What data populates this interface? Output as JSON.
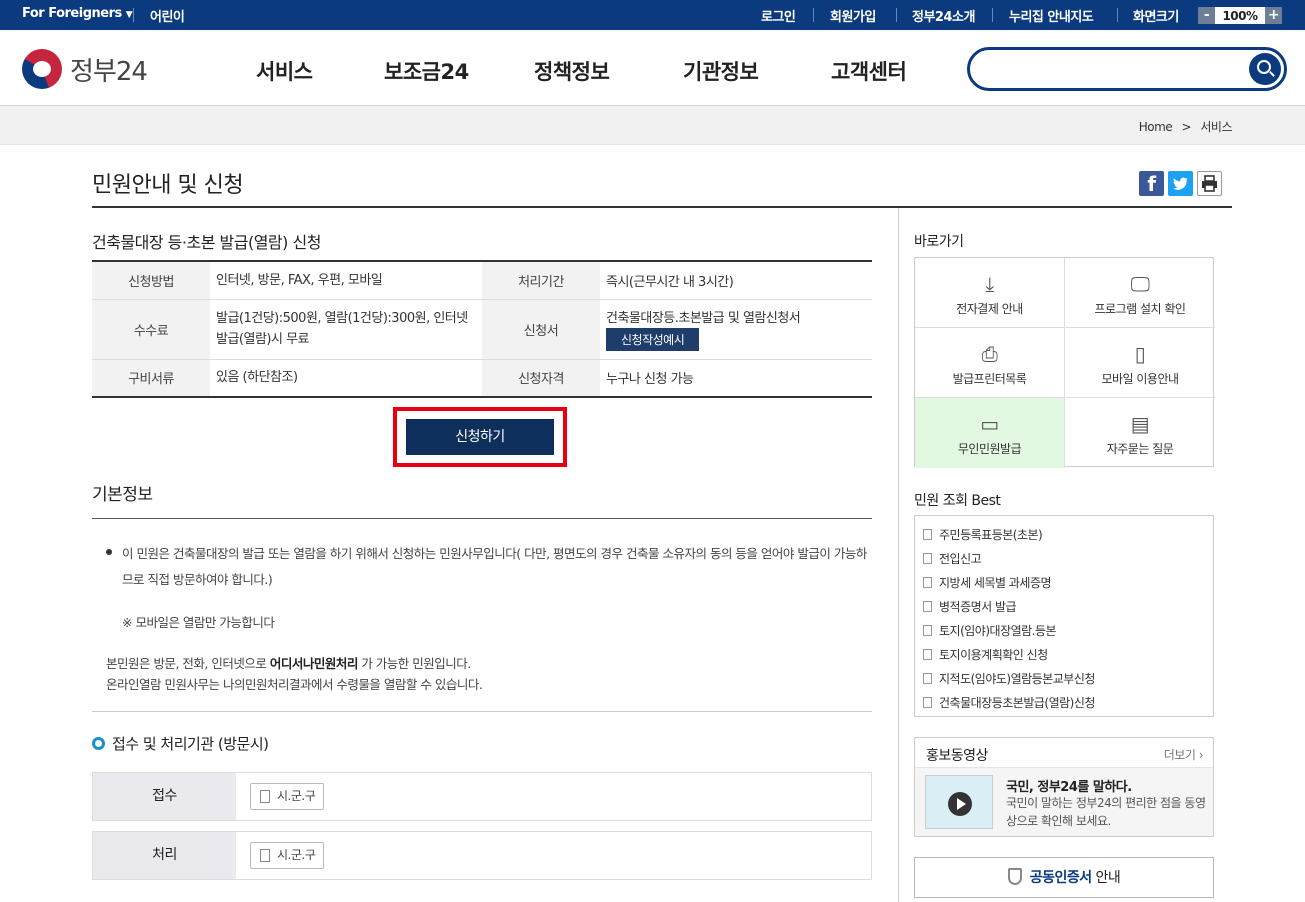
{
  "topbar": {
    "foreigners": "For Foreigners",
    "kids": "어린이",
    "links": [
      "로그인",
      "회원가입",
      "정부24소개",
      "누리집 안내지도",
      "화면크기"
    ],
    "zoom_minus": "-",
    "zoom_value": "100%",
    "zoom_plus": "+"
  },
  "header": {
    "logo_text": "정부24",
    "nav": [
      "서비스",
      "보조금24",
      "정책정보",
      "기관정보",
      "고객센터"
    ],
    "search_placeholder": ""
  },
  "breadcrumb": {
    "home": "Home",
    "sep": ">",
    "current": "서비스"
  },
  "page": {
    "title": "민원안내 및 신청",
    "service_title": "건축물대장 등·초본 발급(열람) 신청"
  },
  "info_table": {
    "method_label": "신청방법",
    "method_value": "인터넷, 방문, FAX, 우편, 모바일",
    "period_label": "처리기간",
    "period_value": "즉시(근무시간 내 3시간)",
    "fee_label": "수수료",
    "fee_value": "발급(1건당):500원, 열람(1건당):300원, 인터넷 발급(열람)시 무료",
    "form_label": "신청서",
    "form_value": "건축물대장등.초본발급 및 열람신청서",
    "form_sample_button": "신청작성예시",
    "docs_label": "구비서류",
    "docs_value": "있음 (하단참조)",
    "qual_label": "신청자격",
    "qual_value": "누구나 신청 가능"
  },
  "apply_button": "신청하기",
  "basic": {
    "title": "기본정보",
    "paragraph1": "이 민원은 건축물대장의 발급 또는 열람을 하기 위해서 신청하는 민원사무입니다( 다만, 평면도의 경우 건축물 소유자의 동의 등을 얻어야 발급이 가능하므로 직접 방문하여야 합니다.)",
    "paragraph2": "※ 모바일은 열람만 가능합니다",
    "line3_pre": "본민원은 방문, 전화, 인터넷으로 ",
    "line3_bold": "어디서나민원처리",
    "line3_post": " 가 가능한 민원입니다.",
    "line4": "온라인열람 민원사무는 나의민원처리결과에서 수령물을 열람할 수 있습니다."
  },
  "org": {
    "title": "접수 및 처리기관 (방문시)",
    "receive_label": "접수",
    "receive_value": "시.군.구",
    "process_label": "처리",
    "process_value": "시.군.구"
  },
  "sidebar": {
    "quick_title": "바로가기",
    "quick": [
      {
        "label": "전자결제 안내",
        "icon": "download-icon"
      },
      {
        "label": "프로그램 설치 확인",
        "icon": "monitor-icon"
      },
      {
        "label": "발급프린터목록",
        "icon": "printer-icon"
      },
      {
        "label": "모바일 이용안내",
        "icon": "mobile-icon"
      },
      {
        "label": "무인민원발급",
        "icon": "kiosk-icon"
      },
      {
        "label": "자주묻는 질문",
        "icon": "chat-icon"
      }
    ],
    "best_title": "민원 조회 Best",
    "best": [
      "주민등록표등본(초본)",
      "전입신고",
      "지방세 세목별 과세증명",
      "병적증명서 발급",
      "토지(임야)대장열람.등본",
      "토지이용계획확인 신청",
      "지적도(임야도)열람등본교부신청",
      "건축물대장등초본발급(열람)신청"
    ],
    "promo_title": "홍보동영상",
    "promo_more": "더보기 ›",
    "promo_headline": "국민, 정부24를 말하다.",
    "promo_desc": "국민이 말하는 정부24의 편리한 점을 동영상으로 확인해 보세요.",
    "cert_highlight": "공동인증서",
    "cert_rest": " 안내"
  }
}
